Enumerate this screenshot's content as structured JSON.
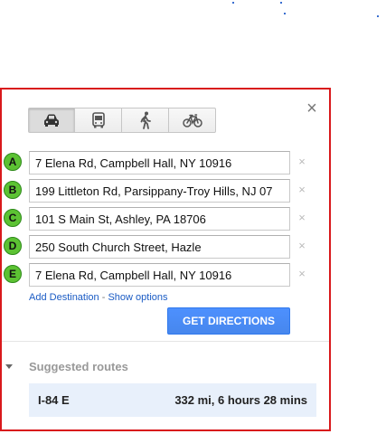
{
  "travel_modes": [
    {
      "name": "driving",
      "icon": "car-icon",
      "active": true
    },
    {
      "name": "transit",
      "icon": "bus-icon",
      "active": false
    },
    {
      "name": "walking",
      "icon": "walking-person-icon",
      "active": false
    },
    {
      "name": "bicycling",
      "icon": "bicycle-icon",
      "active": false
    }
  ],
  "close_icon": "×",
  "remove_icon": "×",
  "waypoints": [
    {
      "letter": "A",
      "value": "7 Elena Rd, Campbell Hall, NY 10916"
    },
    {
      "letter": "B",
      "value": "199 Littleton Rd, Parsippany-Troy Hills, NJ 07"
    },
    {
      "letter": "C",
      "value": "101 S Main St, Ashley, PA 18706"
    },
    {
      "letter": "D",
      "value": "250 South Church Street, Hazle"
    },
    {
      "letter": "E",
      "value": "7 Elena Rd, Campbell Hall, NY 10916"
    }
  ],
  "links": {
    "add_destination": "Add Destination",
    "separator": " - ",
    "show_options": "Show options"
  },
  "get_directions_label": "GET DIRECTIONS",
  "suggested": {
    "title": "Suggested routes",
    "routes": [
      {
        "name": "I-84 E",
        "summary": "332 mi, 6 hours 28 mins"
      }
    ]
  },
  "colors": {
    "panel_border": "#d9191c",
    "marker_green": "#5cc233",
    "button_blue": "#4d90fe",
    "link_blue": "#1a5bc4",
    "route_highlight": "#e8f0fb"
  }
}
